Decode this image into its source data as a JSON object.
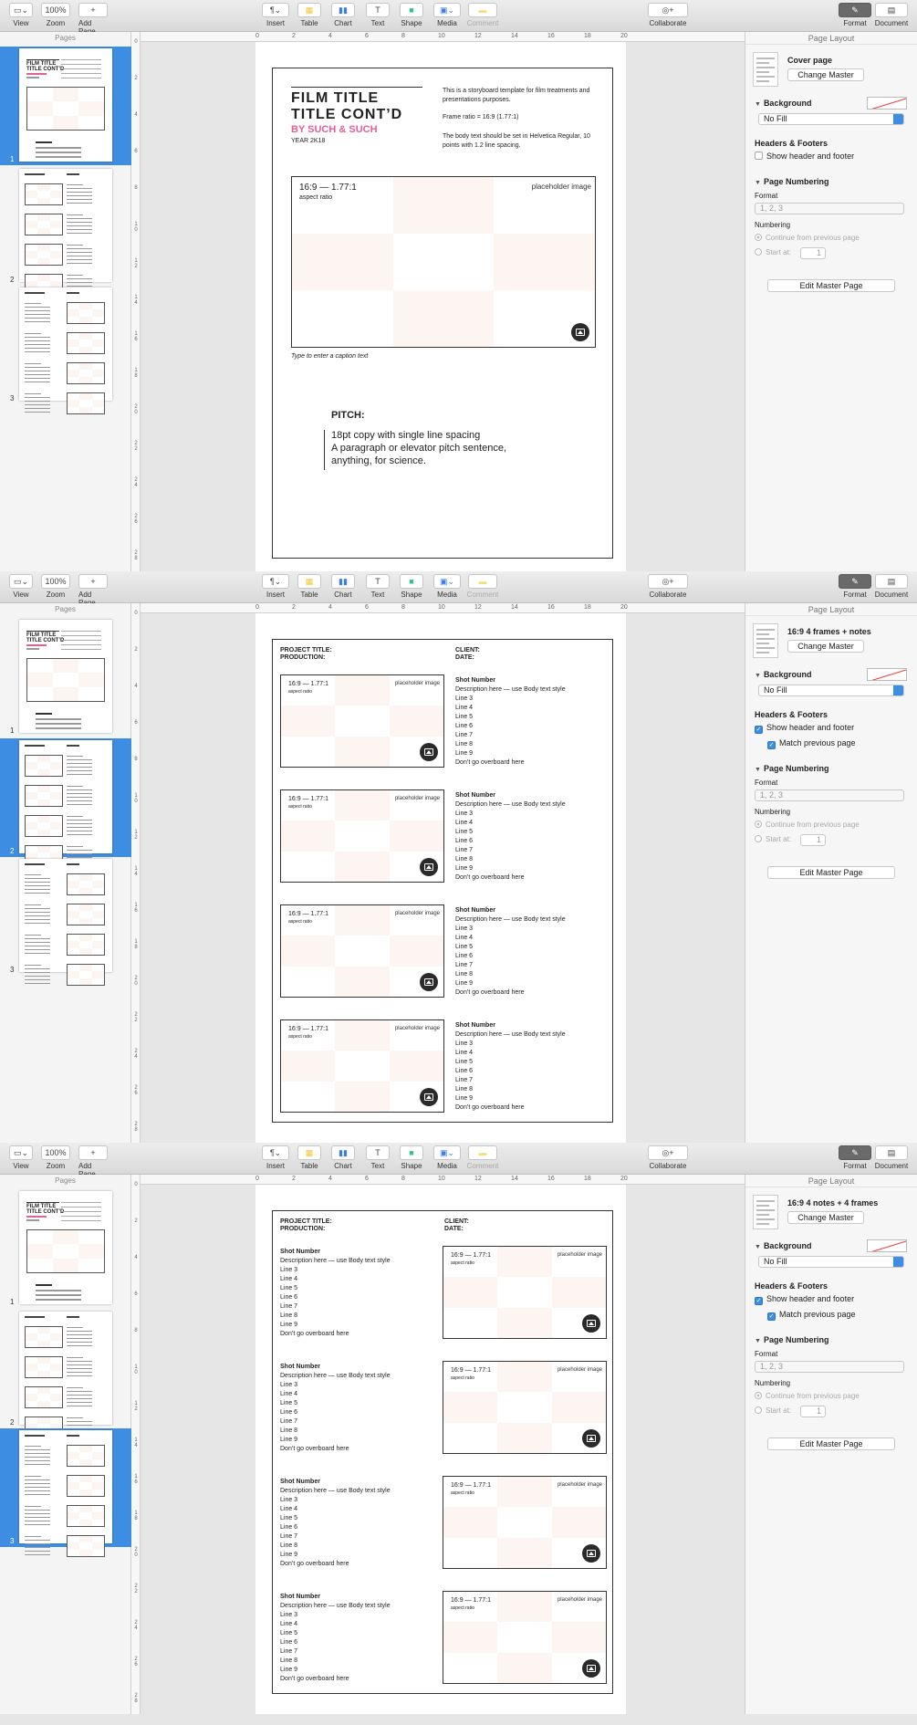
{
  "toolbar": {
    "view": "View",
    "zoom": "Zoom",
    "zoom_value": "100%",
    "add_page": "Add Page",
    "insert": "Insert",
    "table": "Table",
    "chart": "Chart",
    "text": "Text",
    "shape": "Shape",
    "media": "Media",
    "comment": "Comment",
    "collaborate": "Collaborate",
    "format": "Format",
    "document": "Document"
  },
  "sidebar": {
    "title": "Pages",
    "page_numbers": [
      "1",
      "2",
      "3"
    ]
  },
  "rulers": {
    "h": [
      "0",
      "2",
      "4",
      "6",
      "8",
      "10",
      "12",
      "14",
      "16",
      "18",
      "20"
    ],
    "v1": [
      "0",
      "2",
      "4",
      "6",
      "8",
      "1\n0",
      "1\n2",
      "1\n4",
      "1\n6",
      "1\n8",
      "2\n0",
      "2\n2",
      "2\n4",
      "2\n6",
      "2\n8"
    ],
    "v2": [
      "0",
      "2",
      "4",
      "6",
      "8",
      "1\n0",
      "1\n2",
      "1\n4",
      "1\n6",
      "1\n8",
      "2\n0",
      "2\n2",
      "2\n4",
      "2\n6",
      "2\n8"
    ]
  },
  "cover": {
    "title1": "FILM TITLE",
    "title2": "TITLE CONT’D",
    "byline": "BY SUCH & SUCH",
    "year": "YEAR 2K18",
    "intro1": "This is a storyboard template for film treatments and presentations purposes.",
    "intro2": "Frame ratio = 16:9 (1.77:1)",
    "intro3": "The body text should be set in Helvetica Regular, 10 points with 1.2 line spacing.",
    "aspect": "16:9 — 1.77:1",
    "aspect_sub": "aspect ratio",
    "placeholder": "placeholder image",
    "caption": "Type to enter a caption text",
    "pitch_title": "PITCH:",
    "pitch1": "18pt copy with single line spacing",
    "pitch2": "A paragraph or elevator pitch sentence,",
    "pitch3": "anything, for science."
  },
  "storyboard": {
    "project_title": "PROJECT TITLE:",
    "production": "PRODUCTION:",
    "client": "CLIENT:",
    "date": "DATE:",
    "aspect": "16:9 — 1.77:1",
    "aspect_sub": "aspect ratio",
    "placeholder": "placeholder image",
    "shot_number": "Shot Number",
    "description": "Description here — use Body text style",
    "lines": [
      "Line 3",
      "Line 4",
      "Line 5",
      "Line 6",
      "Line 7",
      "Line 8",
      "Line 9"
    ],
    "overboard": "Don’t go overboard here"
  },
  "inspector": {
    "title": "Page Layout",
    "masters": [
      "Cover page",
      "16:9 4 frames + notes",
      "16:9 4 notes + 4 frames"
    ],
    "change_master": "Change Master",
    "background": "Background",
    "fill": "No Fill",
    "headers_footers": "Headers & Footers",
    "show_hf": "Show header and footer",
    "match_prev": "Match previous page",
    "page_numbering": "Page Numbering",
    "format_label": "Format",
    "format_value": "1, 2, 3",
    "numbering": "Numbering",
    "continue": "Continue from previous page",
    "start_at": "Start at:",
    "start_value": "1",
    "edit_master": "Edit Master Page"
  }
}
